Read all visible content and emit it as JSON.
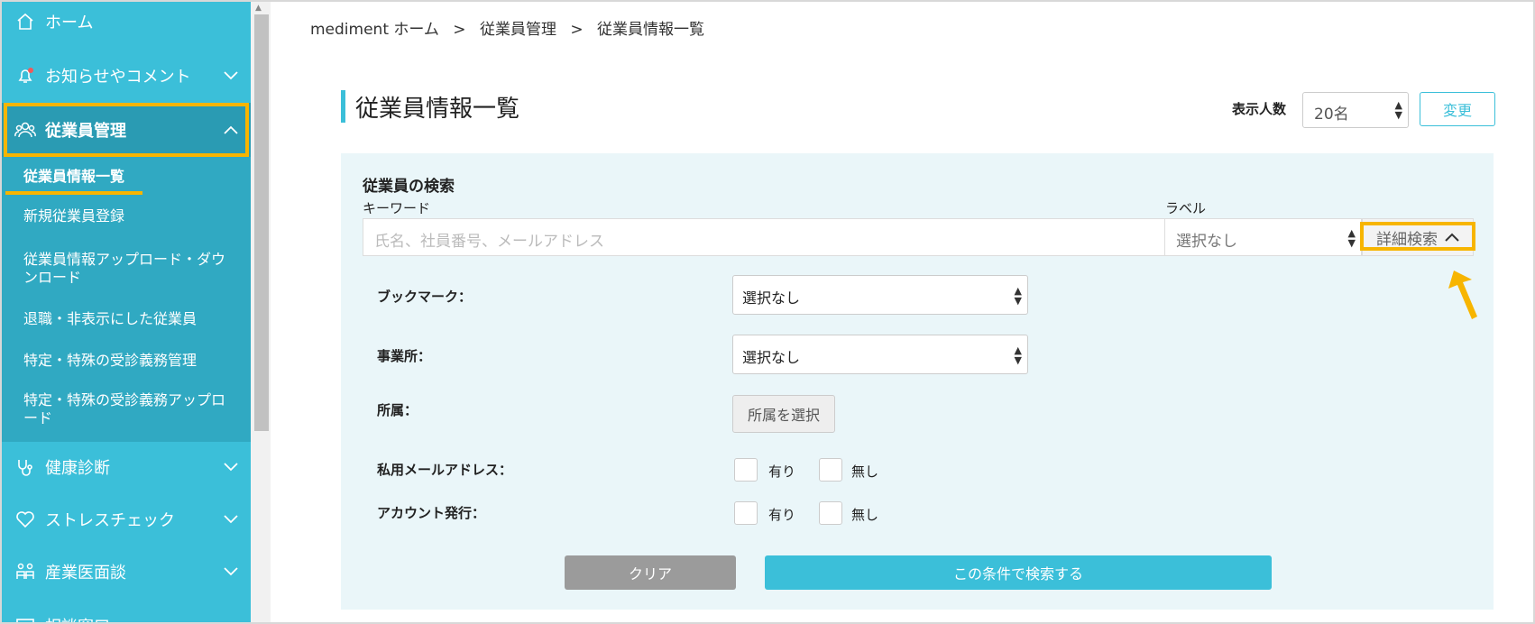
{
  "sidebar": {
    "items": [
      {
        "label": "ホーム",
        "icon": "home-icon"
      },
      {
        "label": "お知らせやコメント",
        "icon": "bell-icon"
      },
      {
        "label": "従業員管理",
        "icon": "people-icon"
      },
      {
        "label": "健康診断",
        "icon": "stethoscope-icon"
      },
      {
        "label": "ストレスチェック",
        "icon": "heart-icon"
      },
      {
        "label": "産業医面談",
        "icon": "meeting-icon"
      },
      {
        "label": "相談窓口",
        "icon": "consult-icon"
      }
    ],
    "submenu": [
      "従業員情報一覧",
      "新規従業員登録",
      "従業員情報アップロード・ダウンロード",
      "退職・非表示にした従業員",
      "特定・特殊の受診義務管理",
      "特定・特殊の受診義務アップロード"
    ]
  },
  "breadcrumb": [
    "mediment ホーム",
    ">",
    "従業員管理",
    ">",
    "従業員情報一覧"
  ],
  "page_title": "従業員情報一覧",
  "display": {
    "label": "表示人数",
    "value": "20名",
    "change_label": "変更"
  },
  "search": {
    "title": "従業員の検索",
    "keyword_label": "キーワード",
    "keyword_placeholder": "氏名、社員番号、メールアドレス",
    "label_label": "ラベル",
    "label_value": "選択なし",
    "advanced_label": "詳細検索",
    "bookmark_label": "ブックマーク：",
    "bookmark_value": "選択なし",
    "office_label": "事業所：",
    "office_value": "選択なし",
    "dept_label": "所属：",
    "dept_button": "所属を選択",
    "private_email_label": "私用メールアドレス：",
    "account_label": "アカウント発行：",
    "yes": "有り",
    "no": "無し",
    "clear_button": "クリア",
    "search_button": "この条件で検索する"
  },
  "colors": {
    "accent": "#3bbfd9",
    "highlight": "#f7b500"
  }
}
